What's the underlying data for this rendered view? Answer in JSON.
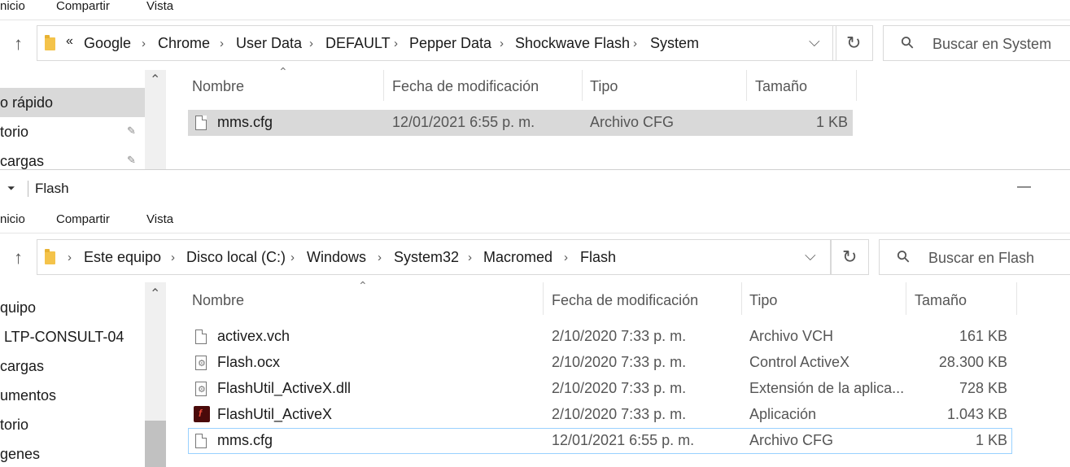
{
  "top_window": {
    "ribbon_tabs": [
      "nicio",
      "Compartir",
      "Vista"
    ],
    "breadcrumb": {
      "overflow": "«",
      "items": [
        "Google",
        "Chrome",
        "User Data",
        "DEFAULT",
        "Pepper Data",
        "Shockwave Flash",
        "System"
      ]
    },
    "search_placeholder": "Buscar en System",
    "nav_items": [
      {
        "label": "o rápido",
        "pinned": false,
        "selected": true
      },
      {
        "label": "torio",
        "pinned": true
      },
      {
        "label": "cargas",
        "pinned": true
      }
    ],
    "columns": {
      "name": "Nombre",
      "date": "Fecha de modificación",
      "type": "Tipo",
      "size": "Tamaño"
    },
    "files": [
      {
        "name": "mms.cfg",
        "date": "12/01/2021 6:55 p. m.",
        "type": "Archivo CFG",
        "size": "1 KB",
        "icon": "file-icon",
        "selected": true
      }
    ]
  },
  "bottom_window": {
    "title": "Flash",
    "quick_access_arrow": "⏷",
    "minimize": "—",
    "ribbon_tabs": [
      "nicio",
      "Compartir",
      "Vista"
    ],
    "breadcrumb": {
      "items": [
        "Este equipo",
        "Disco local (C:)",
        "Windows",
        "System32",
        "Macromed",
        "Flash"
      ]
    },
    "search_placeholder": "Buscar en Flash",
    "nav_items": [
      {
        "label": "quipo"
      },
      {
        "label": "LTP-CONSULT-04"
      },
      {
        "label": "cargas"
      },
      {
        "label": "umentos"
      },
      {
        "label": "torio"
      },
      {
        "label": "genes"
      }
    ],
    "columns": {
      "name": "Nombre",
      "date": "Fecha de modificación",
      "type": "Tipo",
      "size": "Tamaño"
    },
    "files": [
      {
        "name": "activex.vch",
        "date": "2/10/2020 7:33 p. m.",
        "type": "Archivo VCH",
        "size": "161 KB",
        "icon": "file-icon"
      },
      {
        "name": "Flash.ocx",
        "date": "2/10/2020 7:33 p. m.",
        "type": "Control ActiveX",
        "size": "28.300 KB",
        "icon": "gear-file-icon"
      },
      {
        "name": "FlashUtil_ActiveX.dll",
        "date": "2/10/2020 7:33 p. m.",
        "type": "Extensión de la aplica...",
        "size": "728 KB",
        "icon": "gear-file-icon"
      },
      {
        "name": "FlashUtil_ActiveX",
        "date": "2/10/2020 7:33 p. m.",
        "type": "Aplicación",
        "size": "1.043 KB",
        "icon": "flash-app-icon"
      },
      {
        "name": "mms.cfg",
        "date": "12/01/2021 6:55 p. m.",
        "type": "Archivo CFG",
        "size": "1 KB",
        "icon": "file-icon",
        "focused": true
      }
    ]
  },
  "icons": {
    "up": "↑",
    "chevron": "›",
    "dropdown": "⌵",
    "refresh": "↻",
    "search": "⚲",
    "sort_up": "⌃",
    "scroll_up": "⌃",
    "pin": "📌"
  }
}
